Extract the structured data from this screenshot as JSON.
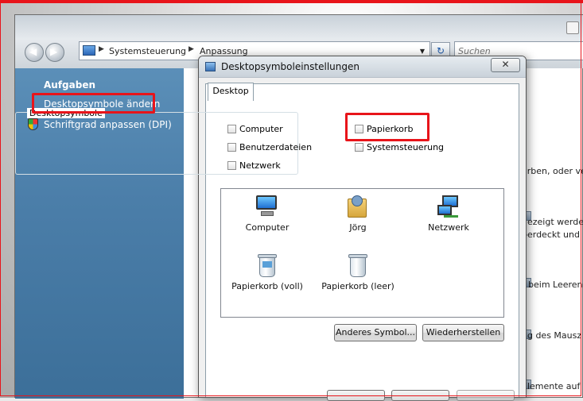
{
  "explorer": {
    "breadcrumb": [
      "Systemsteuerung",
      "Anpassung"
    ],
    "search_placeholder": "Suchen",
    "sidebar": {
      "title": "Aufgaben",
      "links": [
        "Desktopsymbole ändern",
        "Schriftgrad anpassen (DPI)"
      ]
    },
    "background_text": [
      "ärben, oder ve",
      "gezeigt werde",
      "berdeckt und",
      "r beim Leeren",
      "ng des Mausz",
      "Elemente auf"
    ]
  },
  "dialog": {
    "title": "Desktopsymboleinstellungen",
    "close_glyph": "✕",
    "tab": "Desktop",
    "group_label": "Desktopsymbole",
    "checkboxes": [
      {
        "label": "Computer",
        "checked": false
      },
      {
        "label": "Papierkorb",
        "checked": false
      },
      {
        "label": "Benutzerdateien",
        "checked": false
      },
      {
        "label": "Systemsteuerung",
        "checked": false
      },
      {
        "label": "Netzwerk",
        "checked": false
      }
    ],
    "icons": [
      {
        "label": "Computer",
        "icon": "computer-icon"
      },
      {
        "label": "Jörg",
        "icon": "user-folder-icon"
      },
      {
        "label": "Netzwerk",
        "icon": "network-icon"
      },
      {
        "label": "Papierkorb (voll)",
        "icon": "recycle-bin-full-icon"
      },
      {
        "label": "Papierkorb (leer)",
        "icon": "recycle-bin-empty-icon"
      }
    ],
    "buttons": {
      "change_icon": "Anderes Symbol...",
      "restore": "Wiederherstellen"
    }
  },
  "colors": {
    "highlight_red": "#e8141a",
    "sidebar_blue": "#4b7ea9"
  }
}
